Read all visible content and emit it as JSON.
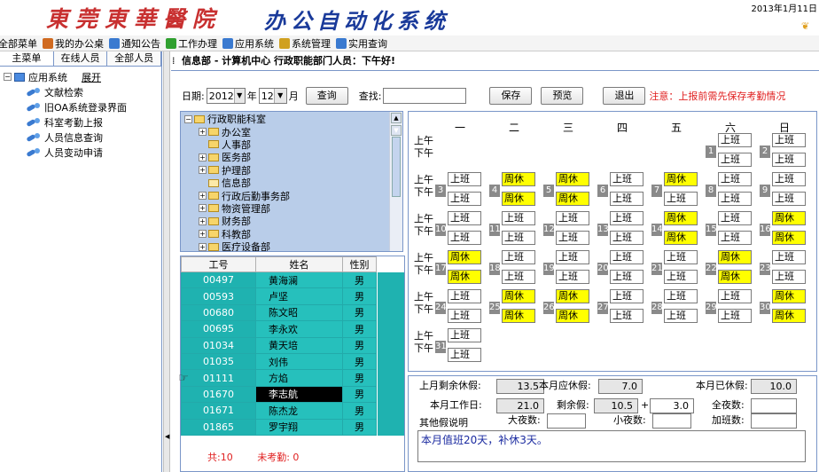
{
  "header": {
    "logo": "東莞東華醫院",
    "app_title": "办公自动化系统",
    "date": "2013年1月11日"
  },
  "toolbar": [
    {
      "label": "全部菜单",
      "icon": "menu-icon",
      "color": "#3a7ad0"
    },
    {
      "label": "我的办公桌",
      "icon": "desk-icon",
      "color": "#d06a20"
    },
    {
      "label": "通知公告",
      "icon": "notice-icon",
      "color": "#3a7ad0"
    },
    {
      "label": "工作办理",
      "icon": "work-icon",
      "color": "#30a030"
    },
    {
      "label": "应用系统",
      "icon": "app-icon",
      "color": "#3a7ad0"
    },
    {
      "label": "系统管理",
      "icon": "admin-icon",
      "color": "#d0a020"
    },
    {
      "label": "实用查询",
      "icon": "query-icon",
      "color": "#3a7ad0"
    }
  ],
  "sidebar": {
    "tabs": [
      "主菜单",
      "在线人员",
      "全部人员"
    ],
    "root": "应用系统",
    "expand": "展开",
    "items": [
      "文献检索",
      "旧OA系统登录界面",
      "科室考勤上报",
      "人员信息查询",
      "人员变动申请"
    ]
  },
  "breadcrumb": "信息部 - 计算机中心 行政职能部门人员：下午好!",
  "filters": {
    "date_label": "日期:",
    "year": "2012",
    "year_unit": "年",
    "month": "12",
    "month_unit": "月",
    "query": "查询",
    "search_label": "查找:",
    "save": "保存",
    "preview": "预览",
    "exit": "退出",
    "warning": "注意：上报前需先保存考勤情况"
  },
  "departments": [
    {
      "label": "行政职能科室",
      "pm": "−",
      "indent": 0
    },
    {
      "label": "办公室",
      "pm": "+",
      "indent": 1
    },
    {
      "label": "人事部",
      "pm": "",
      "indent": 1
    },
    {
      "label": "医务部",
      "pm": "+",
      "indent": 1
    },
    {
      "label": "护理部",
      "pm": "+",
      "indent": 1
    },
    {
      "label": "信息部",
      "pm": "",
      "indent": 1,
      "open": true
    },
    {
      "label": "行政后勤事务部",
      "pm": "+",
      "indent": 1
    },
    {
      "label": "物资管理部",
      "pm": "+",
      "indent": 1
    },
    {
      "label": "财务部",
      "pm": "+",
      "indent": 1
    },
    {
      "label": "科教部",
      "pm": "+",
      "indent": 1
    },
    {
      "label": "医疗设备部",
      "pm": "+",
      "indent": 1
    }
  ],
  "employees": {
    "headers": [
      "工号",
      "姓名",
      "性别"
    ],
    "rows": [
      [
        "00497",
        "黄海澜",
        "男"
      ],
      [
        "00593",
        "卢坚",
        "男"
      ],
      [
        "00680",
        "陈文昭",
        "男"
      ],
      [
        "00695",
        "李永欢",
        "男"
      ],
      [
        "01034",
        "黄天培",
        "男"
      ],
      [
        "01035",
        "刘伟",
        "男"
      ],
      [
        "01111",
        "方焰",
        "男"
      ],
      [
        "01670",
        "李志航",
        "男"
      ],
      [
        "01671",
        "陈杰龙",
        "男"
      ],
      [
        "01865",
        "罗宇翔",
        "男"
      ]
    ],
    "current_index": 7,
    "total": "共:10",
    "missing": "未考勤: 0"
  },
  "calendar": {
    "weekdays": [
      "一",
      "二",
      "三",
      "四",
      "五",
      "六",
      "日"
    ],
    "am": "上午",
    "pm": "下午",
    "colors": {
      "rest": "#ffff00",
      "work": "#ffffff"
    },
    "weeks": [
      [
        null,
        null,
        null,
        null,
        null,
        {
          "d": "1",
          "a": "上班",
          "p": "上班"
        },
        {
          "d": "2",
          "a": "上班",
          "p": "上班"
        }
      ],
      [
        {
          "d": "3",
          "a": "上班",
          "p": "上班"
        },
        {
          "d": "4",
          "a": "周休",
          "p": "周休"
        },
        {
          "d": "5",
          "a": "周休",
          "p": "周休"
        },
        {
          "d": "6",
          "a": "上班",
          "p": "上班"
        },
        {
          "d": "7",
          "a": "周休",
          "p": "上班"
        },
        {
          "d": "8",
          "a": "上班",
          "p": "上班"
        },
        {
          "d": "9",
          "a": "上班",
          "p": "上班"
        }
      ],
      [
        {
          "d": "10",
          "a": "上班",
          "p": "上班"
        },
        {
          "d": "11",
          "a": "上班",
          "p": "上班"
        },
        {
          "d": "12",
          "a": "上班",
          "p": "上班"
        },
        {
          "d": "13",
          "a": "上班",
          "p": "上班"
        },
        {
          "d": "14",
          "a": "周休",
          "p": "周休"
        },
        {
          "d": "15",
          "a": "上班",
          "p": "上班"
        },
        {
          "d": "16",
          "a": "周休",
          "p": "周休"
        }
      ],
      [
        {
          "d": "17",
          "a": "周休",
          "p": "周休"
        },
        {
          "d": "18",
          "a": "上班",
          "p": "上班"
        },
        {
          "d": "19",
          "a": "上班",
          "p": "上班"
        },
        {
          "d": "20",
          "a": "上班",
          "p": "上班"
        },
        {
          "d": "21",
          "a": "上班",
          "p": "上班"
        },
        {
          "d": "22",
          "a": "周休",
          "p": "周休"
        },
        {
          "d": "23",
          "a": "上班",
          "p": "上班"
        }
      ],
      [
        {
          "d": "24",
          "a": "上班",
          "p": "上班"
        },
        {
          "d": "25",
          "a": "周休",
          "p": "周休"
        },
        {
          "d": "26",
          "a": "周休",
          "p": "周休"
        },
        {
          "d": "27",
          "a": "上班",
          "p": "上班"
        },
        {
          "d": "28",
          "a": "上班",
          "p": "上班"
        },
        {
          "d": "29",
          "a": "上班",
          "p": "上班"
        },
        {
          "d": "30",
          "a": "周休",
          "p": "周休"
        }
      ],
      [
        {
          "d": "31",
          "a": "上班",
          "p": "上班"
        },
        null,
        null,
        null,
        null,
        null,
        null
      ]
    ]
  },
  "leave": {
    "last_month_remaining_label": "上月剩余休假:",
    "last_month_remaining": "13.5",
    "month_due_label": "本月应休假:",
    "month_due": "7.0",
    "month_taken_label": "本月已休假:",
    "month_taken": "10.0",
    "work_days_label": "本月工作日:",
    "work_days": "21.0",
    "remaining_label": "剩余假:",
    "remaining": "10.5",
    "plus": "+",
    "extra": "3.0",
    "full_night_label": "全夜数:",
    "other_label": "其他假说明",
    "big_night_label": "大夜数:",
    "small_night_label": "小夜数:",
    "overtime_label": "加班数:",
    "remark": "本月值班20天，补休3天。"
  }
}
